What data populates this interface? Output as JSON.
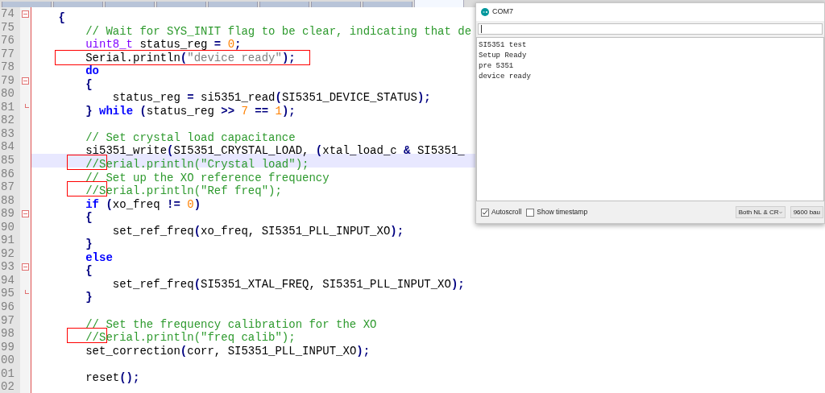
{
  "editor_tabs": [
    {
      "selected": false
    },
    {
      "selected": false
    },
    {
      "selected": false
    },
    {
      "selected": false
    },
    {
      "selected": false
    },
    {
      "selected": false
    },
    {
      "selected": false
    },
    {
      "selected": false
    },
    {
      "selected": true
    }
  ],
  "code_lines": [
    {
      "number": "74",
      "fold": {
        "kind": "open"
      },
      "current": false,
      "segments": [
        {
          "kind": "operator",
          "text": "    {"
        }
      ]
    },
    {
      "number": "75",
      "current": false,
      "segments": [
        {
          "kind": "comment",
          "text": "        // Wait for SYS_INIT flag to be clear, indicating that de"
        }
      ]
    },
    {
      "number": "76",
      "current": false,
      "segments": [
        {
          "kind": "type",
          "text": "        uint8_t"
        },
        {
          "kind": "plain",
          "text": " status_reg "
        },
        {
          "kind": "operator",
          "text": "="
        },
        {
          "kind": "number",
          "text": " 0"
        },
        {
          "kind": "operator",
          "text": ";"
        }
      ]
    },
    {
      "number": "77",
      "current": false,
      "annotation": {
        "kind": "full"
      },
      "segments": [
        {
          "kind": "plain",
          "text": "        Serial.println"
        },
        {
          "kind": "operator",
          "text": "("
        },
        {
          "kind": "string",
          "text": "\"device ready\""
        },
        {
          "kind": "operator",
          "text": ");"
        }
      ]
    },
    {
      "number": "78",
      "current": false,
      "segments": [
        {
          "kind": "keyword",
          "text": "        do"
        }
      ]
    },
    {
      "number": "79",
      "fold": {
        "kind": "open"
      },
      "current": false,
      "segments": [
        {
          "kind": "operator",
          "text": "        {"
        }
      ]
    },
    {
      "number": "80",
      "current": false,
      "segments": [
        {
          "kind": "plain",
          "text": "            status_reg "
        },
        {
          "kind": "operator",
          "text": "="
        },
        {
          "kind": "plain",
          "text": " si5351_read"
        },
        {
          "kind": "operator",
          "text": "("
        },
        {
          "kind": "plain",
          "text": "SI5351_DEVICE_STATUS"
        },
        {
          "kind": "operator",
          "text": ");"
        }
      ]
    },
    {
      "number": "81",
      "fold": {
        "kind": "end"
      },
      "current": false,
      "segments": [
        {
          "kind": "operator",
          "text": "        }"
        },
        {
          "kind": "keyword",
          "text": " while"
        },
        {
          "kind": "operator",
          "text": " ("
        },
        {
          "kind": "plain",
          "text": "status_reg "
        },
        {
          "kind": "operator",
          "text": ">>"
        },
        {
          "kind": "number",
          "text": " 7"
        },
        {
          "kind": "operator",
          "text": " =="
        },
        {
          "kind": "number",
          "text": " 1"
        },
        {
          "kind": "operator",
          "text": ");"
        }
      ]
    },
    {
      "number": "82",
      "current": false
    },
    {
      "number": "83",
      "current": false,
      "segments": [
        {
          "kind": "comment",
          "text": "        // Set crystal load capacitance"
        }
      ]
    },
    {
      "number": "84",
      "current": false,
      "segments": [
        {
          "kind": "plain",
          "text": "        si5351_write"
        },
        {
          "kind": "operator",
          "text": "("
        },
        {
          "kind": "plain",
          "text": "SI5351_CRYSTAL_LOAD,"
        },
        {
          "kind": "operator",
          "text": " ("
        },
        {
          "kind": "plain",
          "text": "xtal_load_c "
        },
        {
          "kind": "operator",
          "text": "&"
        },
        {
          "kind": "plain",
          "text": " SI5351_"
        }
      ]
    },
    {
      "number": "85",
      "current": true,
      "annotation": {
        "kind": "prefix"
      },
      "segments": [
        {
          "kind": "comment",
          "text": "        //Serial.println(\"Crystal load\");"
        }
      ]
    },
    {
      "number": "86",
      "current": false,
      "segments": [
        {
          "kind": "comment",
          "text": "        // Set up the XO reference frequency"
        }
      ]
    },
    {
      "number": "87",
      "current": false,
      "annotation": {
        "kind": "prefix"
      },
      "segments": [
        {
          "kind": "comment",
          "text": "        //Serial.println(\"Ref freq\");"
        }
      ]
    },
    {
      "number": "88",
      "current": false,
      "segments": [
        {
          "kind": "keyword",
          "text": "        if"
        },
        {
          "kind": "operator",
          "text": " ("
        },
        {
          "kind": "plain",
          "text": "xo_freq "
        },
        {
          "kind": "operator",
          "text": "!="
        },
        {
          "kind": "number",
          "text": " 0"
        },
        {
          "kind": "operator",
          "text": ")"
        }
      ]
    },
    {
      "number": "89",
      "fold": {
        "kind": "open"
      },
      "current": false,
      "segments": [
        {
          "kind": "operator",
          "text": "        {"
        }
      ]
    },
    {
      "number": "90",
      "current": false,
      "segments": [
        {
          "kind": "plain",
          "text": "            set_ref_freq"
        },
        {
          "kind": "operator",
          "text": "("
        },
        {
          "kind": "plain",
          "text": "xo_freq, SI5351_PLL_INPUT_XO"
        },
        {
          "kind": "operator",
          "text": ");"
        }
      ]
    },
    {
      "number": "91",
      "current": false,
      "segments": [
        {
          "kind": "operator",
          "text": "        }"
        }
      ]
    },
    {
      "number": "92",
      "current": false,
      "segments": [
        {
          "kind": "keyword",
          "text": "        else"
        }
      ]
    },
    {
      "number": "93",
      "fold": {
        "kind": "open"
      },
      "current": false,
      "segments": [
        {
          "kind": "operator",
          "text": "        {"
        }
      ]
    },
    {
      "number": "94",
      "current": false,
      "segments": [
        {
          "kind": "plain",
          "text": "            set_ref_freq"
        },
        {
          "kind": "operator",
          "text": "("
        },
        {
          "kind": "plain",
          "text": "SI5351_XTAL_FREQ, SI5351_PLL_INPUT_XO"
        },
        {
          "kind": "operator",
          "text": ");"
        }
      ]
    },
    {
      "number": "95",
      "fold": {
        "kind": "end"
      },
      "current": false,
      "segments": [
        {
          "kind": "operator",
          "text": "        }"
        }
      ]
    },
    {
      "number": "96",
      "current": false
    },
    {
      "number": "97",
      "current": false,
      "segments": [
        {
          "kind": "comment",
          "text": "        // Set the frequency calibration for the XO"
        }
      ]
    },
    {
      "number": "98",
      "current": false,
      "annotation": {
        "kind": "prefix"
      },
      "segments": [
        {
          "kind": "comment",
          "text": "        //Serial.println(\"freq calib\");"
        }
      ]
    },
    {
      "number": "99",
      "current": false,
      "segments": [
        {
          "kind": "plain",
          "text": "        set_correction"
        },
        {
          "kind": "operator",
          "text": "("
        },
        {
          "kind": "plain",
          "text": "corr, SI5351_PLL_INPUT_XO"
        },
        {
          "kind": "operator",
          "text": ");"
        }
      ]
    },
    {
      "number": "00",
      "current": false
    },
    {
      "number": "01",
      "current": false,
      "segments": [
        {
          "kind": "plain",
          "text": "        reset"
        },
        {
          "kind": "operator",
          "text": "();"
        }
      ]
    },
    {
      "number": "02",
      "current": false
    }
  ],
  "serial_monitor": {
    "title": "COM7",
    "output_lines": [
      "SI5351 test",
      "Setup Ready",
      "pre 5351",
      "device ready"
    ],
    "autoscroll": {
      "label": "Autoscroll",
      "checked": true
    },
    "show_timestamp": {
      "label": "Show timestamp",
      "checked": false
    },
    "line_ending": "Both NL & CR",
    "baud_rate": "9600 bau"
  }
}
